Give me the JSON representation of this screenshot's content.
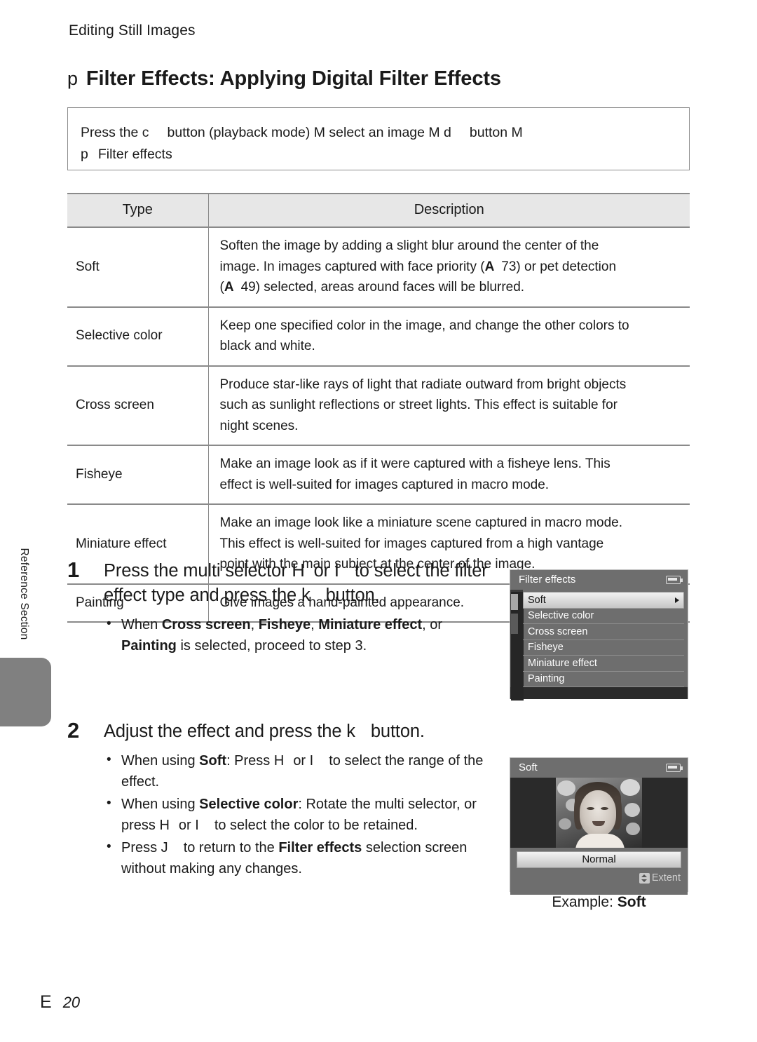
{
  "running_head": "Editing Still Images",
  "title": {
    "symbol": "p",
    "text": "Filter Effects: Applying Digital Filter Effects"
  },
  "path_box": {
    "line1_a": "Press the c",
    "line1_b": "button (playback mode) M select an image M d",
    "line1_c": "button M",
    "line2_sym": "p",
    "line2_text": "Filter effects"
  },
  "table": {
    "headers": [
      "Type",
      "Description"
    ],
    "rows": [
      {
        "type": "Soft",
        "desc_1": "Soften the image by adding a slight blur around the center of the",
        "desc_2a": "image. In images captured with face priority (",
        "desc_2ref": "A",
        "desc_2b": "73) or pet detection",
        "desc_3a": "(",
        "desc_3ref": "A",
        "desc_3b": "49) selected, areas around faces will be blurred."
      },
      {
        "type": "Selective color",
        "desc_1": "Keep one specified color in the image, and change the other colors to",
        "desc_2": "black and white."
      },
      {
        "type": "Cross screen",
        "desc_1": "Produce star-like rays of light that radiate outward from bright objects",
        "desc_2": "such as sunlight reflections or street lights. This effect is suitable for",
        "desc_3": "night scenes."
      },
      {
        "type": "Fisheye",
        "desc_1": "Make an image look as if it were captured with a fisheye lens. This",
        "desc_2": "effect is well-suited for images captured in macro mode."
      },
      {
        "type": "Miniature effect",
        "desc_1": "Make an image look like a miniature scene captured in macro mode.",
        "desc_2": "This effect is well-suited for images captured from a high vantage",
        "desc_3": "point with the main subject at the center of the image."
      },
      {
        "type": "Painting",
        "desc_1": "Give images a hand-painted appearance."
      }
    ]
  },
  "side_tab_label": "Reference Section",
  "steps": [
    {
      "num": "1",
      "head_a": "Press the multi selector H",
      "head_b": "or I",
      "head_c": "to select the",
      "head_d": "filter effect type and press the k",
      "head_e": "button.",
      "bullets": [
        {
          "p1": "When ",
          "b1": "Cross screen",
          "p2": ", ",
          "b2": "Fisheye",
          "p3": ", ",
          "b3": "Miniature effect",
          "p4": ", or ",
          "b4": "Painting",
          "p5": " is selected, proceed to step 3."
        }
      ]
    },
    {
      "num": "2",
      "head_a": "Adjust the effect and press the k",
      "head_b": "button.",
      "bullets": [
        {
          "p1": "When using ",
          "b1": "Soft",
          "p2": ": Press H",
          "p3": "or I",
          "p4": "to select the range of the effect."
        },
        {
          "p1": "When using ",
          "b1": "Selective color",
          "p2": ": Rotate the multi selector, or press H",
          "p3": "or I",
          "p4": "to select the color to be retained."
        },
        {
          "p1": "Press J",
          "p2": "to return to the ",
          "b1": "Filter effects",
          "p3": " selection screen without making any changes."
        }
      ]
    }
  ],
  "camera_menu": {
    "title": "Filter effects",
    "battery_icon": "battery-icon",
    "items": [
      {
        "label": "Soft",
        "selected": true,
        "arrow_icon": "chevron-right-icon"
      },
      {
        "label": "Selective color",
        "selected": false
      },
      {
        "label": "Cross screen",
        "selected": false
      },
      {
        "label": "Fisheye",
        "selected": false
      },
      {
        "label": "Miniature effect",
        "selected": false
      },
      {
        "label": "Painting",
        "selected": false
      }
    ]
  },
  "camera_preview": {
    "title": "Soft",
    "battery_icon": "battery-icon",
    "slider_value": "Normal",
    "hint_icon": "up-down-arrow-icon",
    "hint_label": "Extent"
  },
  "example_caption": {
    "prefix": "Example: ",
    "bold": "Soft"
  },
  "folio": {
    "mark": "E",
    "page": "20"
  }
}
